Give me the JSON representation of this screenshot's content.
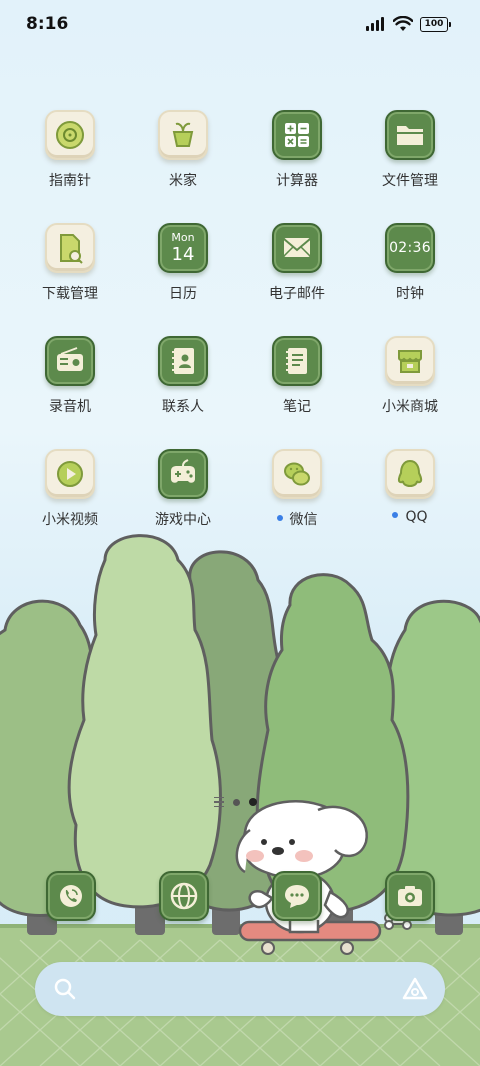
{
  "status_bar": {
    "time": "8:16",
    "battery": "100"
  },
  "apps": [
    {
      "label": "指南针",
      "icon": "compass-icon",
      "style": "cream"
    },
    {
      "label": "米家",
      "icon": "mijia-icon",
      "style": "cream"
    },
    {
      "label": "计算器",
      "icon": "calculator-icon",
      "style": "green"
    },
    {
      "label": "文件管理",
      "icon": "folder-icon",
      "style": "green"
    },
    {
      "label": "下载管理",
      "icon": "download-icon",
      "style": "cream"
    },
    {
      "label": "日历",
      "icon": "calendar-icon",
      "style": "green",
      "cal_month": "Mon",
      "cal_day": "14"
    },
    {
      "label": "电子邮件",
      "icon": "mail-icon",
      "style": "green"
    },
    {
      "label": "时钟",
      "icon": "clock-icon",
      "style": "green",
      "clock_time": "02:36"
    },
    {
      "label": "录音机",
      "icon": "recorder-icon",
      "style": "green"
    },
    {
      "label": "联系人",
      "icon": "contacts-icon",
      "style": "green"
    },
    {
      "label": "笔记",
      "icon": "notes-icon",
      "style": "green"
    },
    {
      "label": "小米商城",
      "icon": "store-icon",
      "style": "cream"
    },
    {
      "label": "小米视频",
      "icon": "video-icon",
      "style": "cream"
    },
    {
      "label": "游戏中心",
      "icon": "gamepad-icon",
      "style": "green"
    },
    {
      "label": "微信",
      "icon": "wechat-icon",
      "style": "cream",
      "new_dot": true
    },
    {
      "label": "QQ",
      "icon": "qq-icon",
      "style": "cream",
      "new_dot": true
    }
  ],
  "page_indicator": {
    "pages": 2,
    "current": 2
  },
  "dock": [
    "phone-icon",
    "browser-icon",
    "messages-icon",
    "camera-icon"
  ],
  "search": {
    "search_icon": "search-icon",
    "assistant_icon": "assistant-icon"
  },
  "colors": {
    "icon_green": "#5d8a4c",
    "icon_cream": "#f4efe0",
    "dot_blue": "#3a7fe6"
  }
}
